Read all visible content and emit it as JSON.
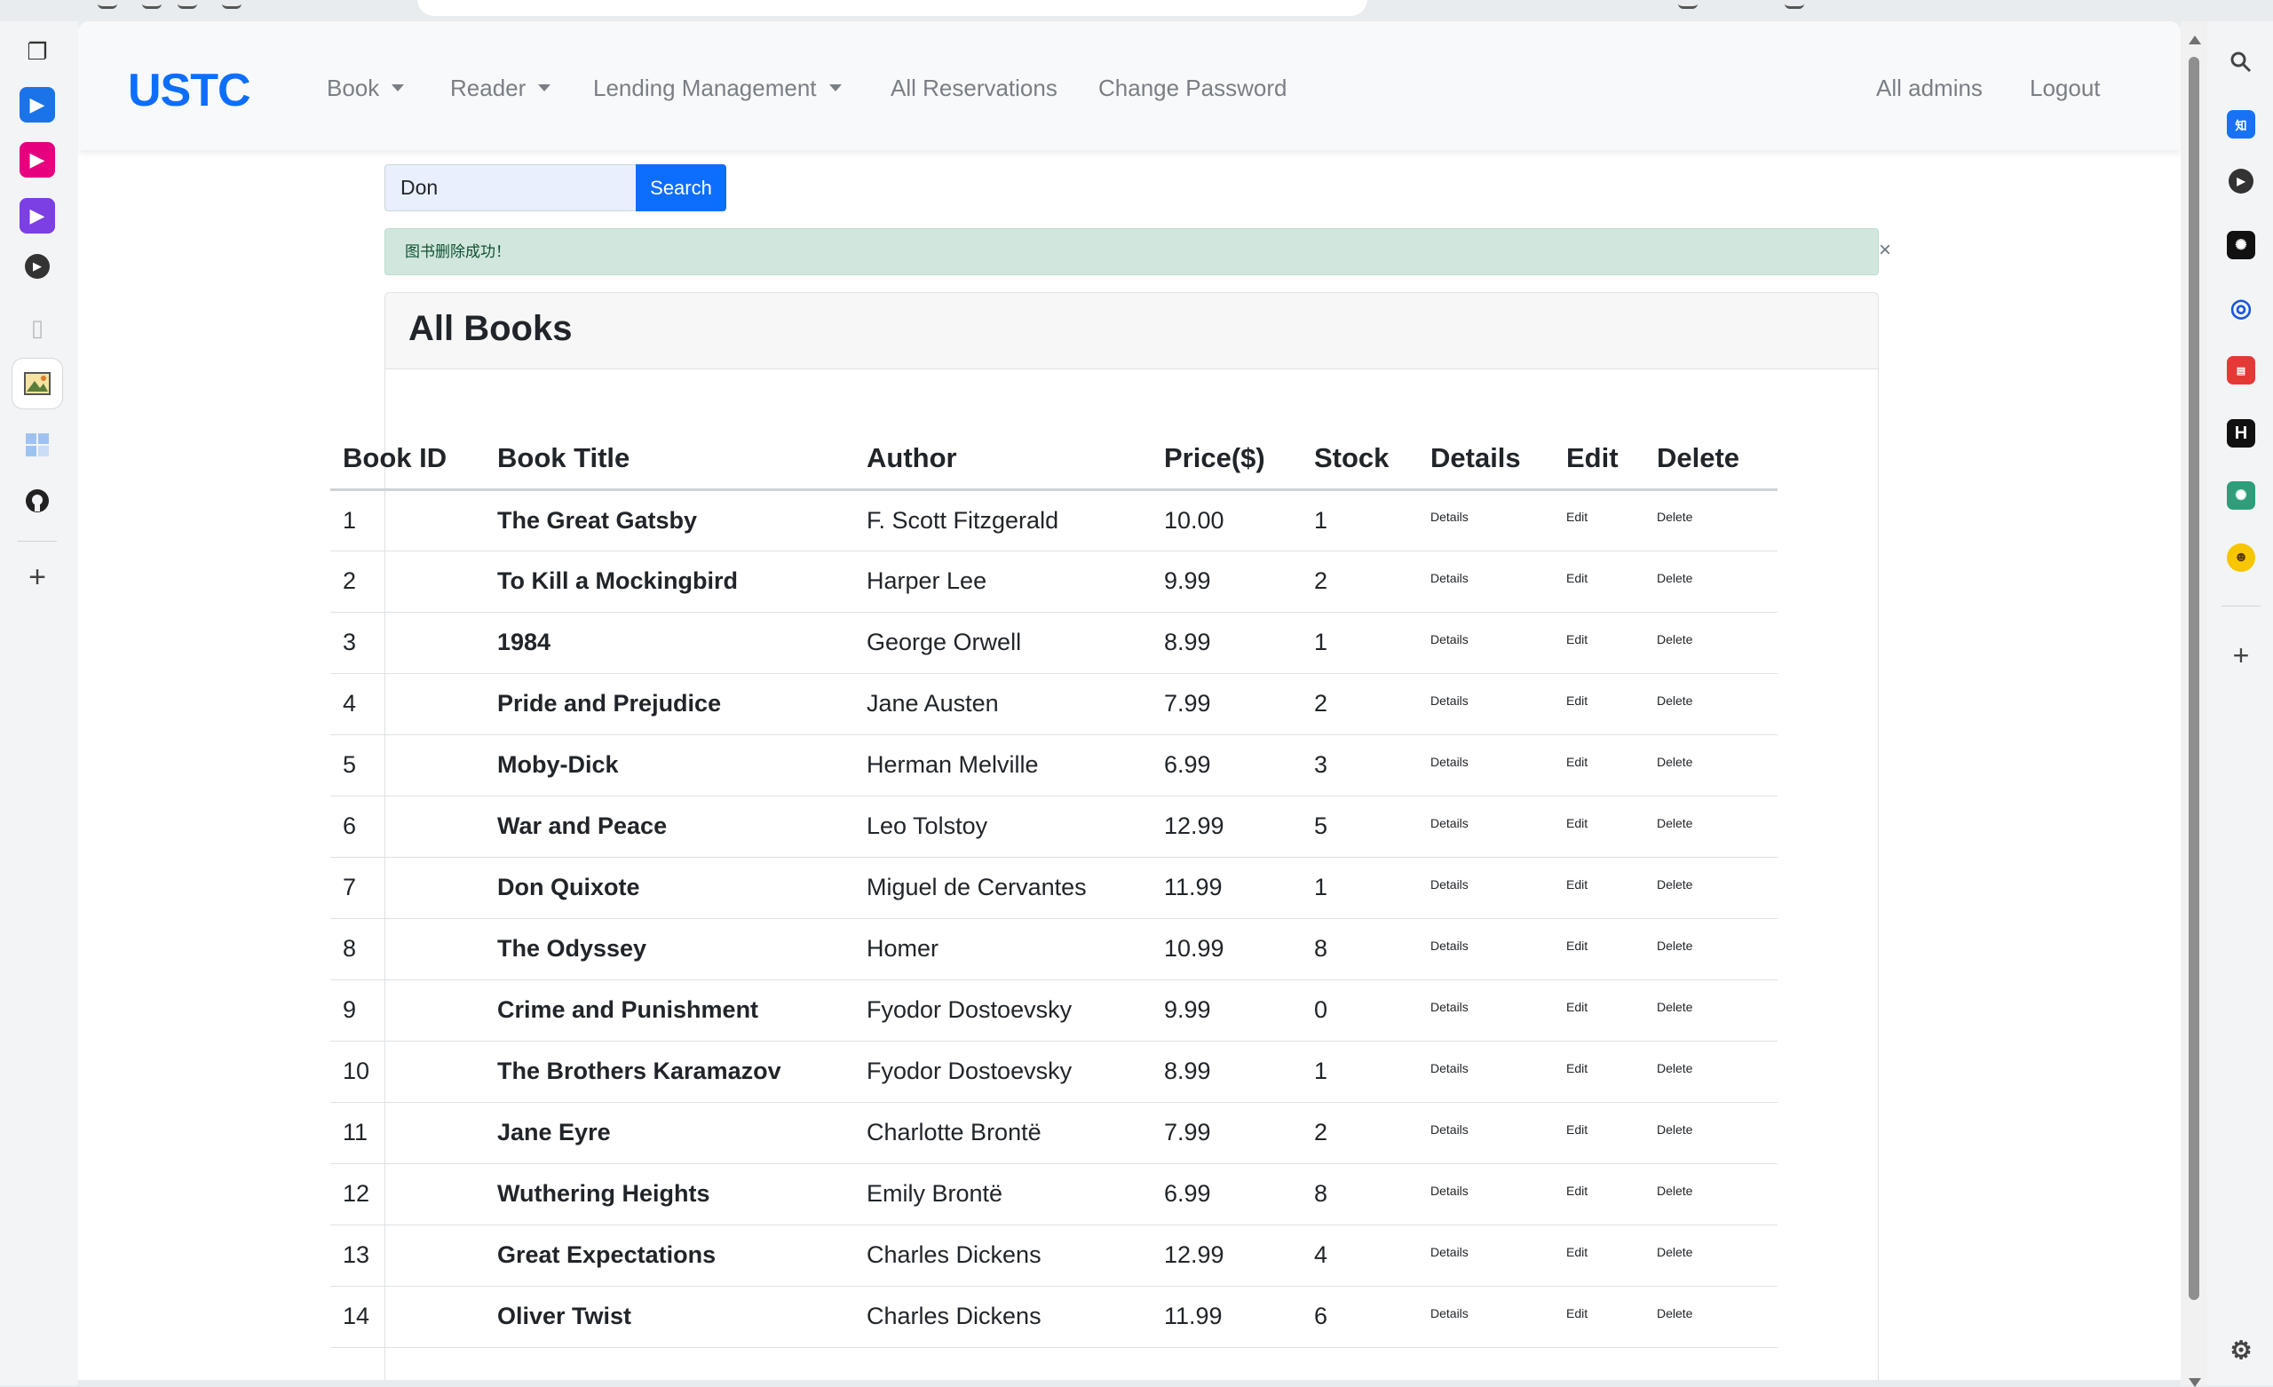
{
  "navbar": {
    "brand": "USTC",
    "menus": [
      "Book",
      "Reader",
      "Lending Management"
    ],
    "links": [
      "All Reservations",
      "Change Password"
    ],
    "right_links": [
      "All admins",
      "Logout"
    ]
  },
  "search": {
    "value": "Don",
    "button_label": "Search"
  },
  "alert": {
    "message": "图书删除成功！",
    "close_symbol": "×"
  },
  "card": {
    "title": "All Books"
  },
  "table": {
    "headers": [
      "Book ID",
      "Book Title",
      "Author",
      "Price($)",
      "Stock",
      "Details",
      "Edit",
      "Delete"
    ],
    "action_labels": {
      "details": "Details",
      "edit": "Edit",
      "delete": "Delete"
    },
    "rows": [
      {
        "id": "1",
        "title": "The Great Gatsby",
        "author": "F. Scott Fitzgerald",
        "price": "10.00",
        "stock": "1"
      },
      {
        "id": "2",
        "title": "To Kill a Mockingbird",
        "author": "Harper Lee",
        "price": "9.99",
        "stock": "2"
      },
      {
        "id": "3",
        "title": "1984",
        "author": "George Orwell",
        "price": "8.99",
        "stock": "1"
      },
      {
        "id": "4",
        "title": "Pride and Prejudice",
        "author": "Jane Austen",
        "price": "7.99",
        "stock": "2"
      },
      {
        "id": "5",
        "title": "Moby-Dick",
        "author": "Herman Melville",
        "price": "6.99",
        "stock": "3"
      },
      {
        "id": "6",
        "title": "War and Peace",
        "author": "Leo Tolstoy",
        "price": "12.99",
        "stock": "5"
      },
      {
        "id": "7",
        "title": "Don Quixote",
        "author": "Miguel de Cervantes",
        "price": "11.99",
        "stock": "1"
      },
      {
        "id": "8",
        "title": "The Odyssey",
        "author": "Homer",
        "price": "10.99",
        "stock": "8"
      },
      {
        "id": "9",
        "title": "Crime and Punishment",
        "author": "Fyodor Dostoevsky",
        "price": "9.99",
        "stock": "0"
      },
      {
        "id": "10",
        "title": "The Brothers Karamazov",
        "author": "Fyodor Dostoevsky",
        "price": "8.99",
        "stock": "1"
      },
      {
        "id": "11",
        "title": "Jane Eyre",
        "author": "Charlotte Brontë",
        "price": "7.99",
        "stock": "2"
      },
      {
        "id": "12",
        "title": "Wuthering Heights",
        "author": "Emily Brontë",
        "price": "6.99",
        "stock": "8"
      },
      {
        "id": "13",
        "title": "Great Expectations",
        "author": "Charles Dickens",
        "price": "12.99",
        "stock": "4"
      },
      {
        "id": "14",
        "title": "Oliver Twist",
        "author": "Charles Dickens",
        "price": "11.99",
        "stock": "6"
      }
    ]
  },
  "browser_sidebar": {
    "left_icons": [
      "tabs-icon",
      "video-app-icon-blue",
      "video-app-icon-pink",
      "video-app-icon-purple",
      "play-circle-icon",
      "document-icon",
      "image-app-icon",
      "grid-app-icon",
      "github-icon",
      "add-icon"
    ],
    "right_icons": [
      "search-icon",
      "zhihu-icon",
      "play-circle-icon",
      "chatgpt-icon",
      "edge-icon",
      "news-app-icon",
      "h-app-icon",
      "chatgpt-green-icon",
      "emoji-icon",
      "add-icon",
      "settings-icon"
    ],
    "colors": {
      "blue": "#1a73e8",
      "pink": "#e6007e",
      "purple": "#7b3fe4",
      "brand": "#0d6efd"
    }
  }
}
